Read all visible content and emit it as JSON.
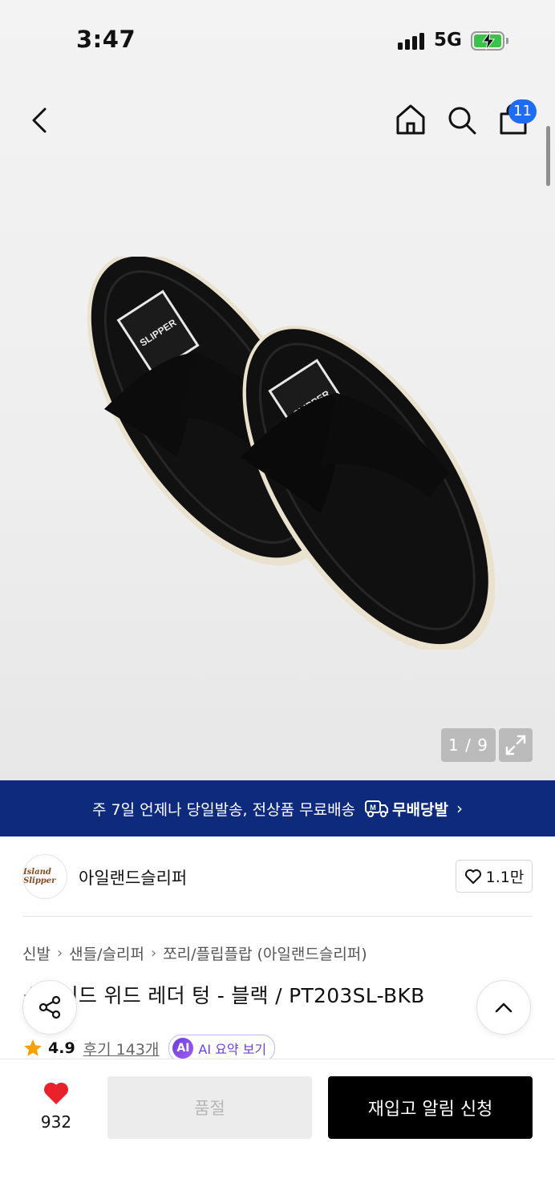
{
  "status_bar": {
    "time": "3:47",
    "network": "5G",
    "battery": "charging"
  },
  "nav": {
    "back_icon": "chevron-left-icon",
    "home_icon": "home-icon",
    "search_icon": "search-icon",
    "cart_icon": "shopping-bag-icon",
    "cart_count": "11"
  },
  "gallery": {
    "counter": "1 / 9",
    "expand_icon": "expand-icon"
  },
  "banner": {
    "text": "주 7일 언제나 당일발송, 전상품 무료배송",
    "badge": "무배당발",
    "badge_icon": "delivery-truck-icon"
  },
  "brand": {
    "name": "아일랜드슬리퍼",
    "like_count": "1.1만",
    "logo_text": "Island Slipper"
  },
  "breadcrumb": [
    "신발",
    "샌들/슬리퍼",
    "쪼리/플립플랍 (아일랜드슬리퍼)"
  ],
  "product": {
    "title": "스웨이드 위드 레더 텅 - 블랙 / PT203SL-BKB",
    "rating": "4.9",
    "reviews": "후기 143개",
    "ai_badge": "AI",
    "ai_label": "AI 요약 보기"
  },
  "bottom_bar": {
    "wish_count": "932",
    "soldout_label": "품절",
    "restock_label": "재입고 알림 신청"
  },
  "colors": {
    "banner": "#0e2a7c",
    "badge": "#1e6cf2",
    "heart": "#e8212b",
    "star": "#f5a100"
  }
}
